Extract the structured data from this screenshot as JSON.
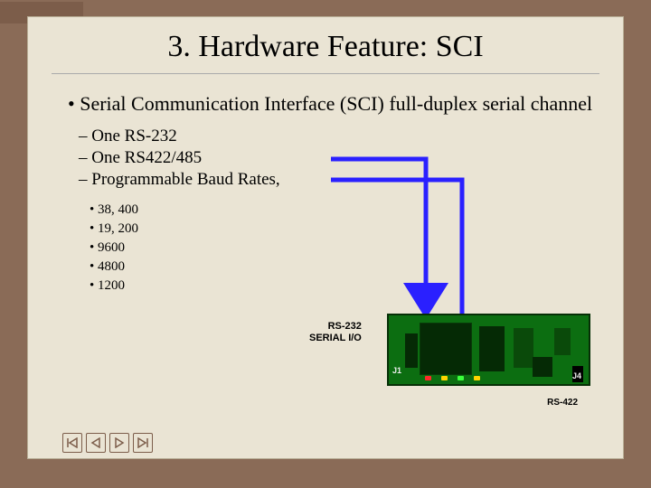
{
  "slide": {
    "title": "3. Hardware Feature: SCI",
    "bullet_main": "Serial Communication Interface (SCI) full-duplex serial channel",
    "sub_bullets": {
      "a": "One RS-232",
      "b": "One RS422/485",
      "c": "Programmable Baud Rates,"
    },
    "baud_rates": {
      "r1": "38, 400",
      "r2": "19, 200",
      "r3": "9600",
      "r4": "4800",
      "r5": "1200"
    }
  },
  "board": {
    "label1": "RS-232",
    "label2": "SERIAL I/O",
    "j1": "J1",
    "j4": "J4",
    "rs422": "RS-422"
  },
  "nav": {
    "first": "first-slide",
    "prev": "previous-slide",
    "next": "next-slide",
    "last": "last-slide"
  }
}
